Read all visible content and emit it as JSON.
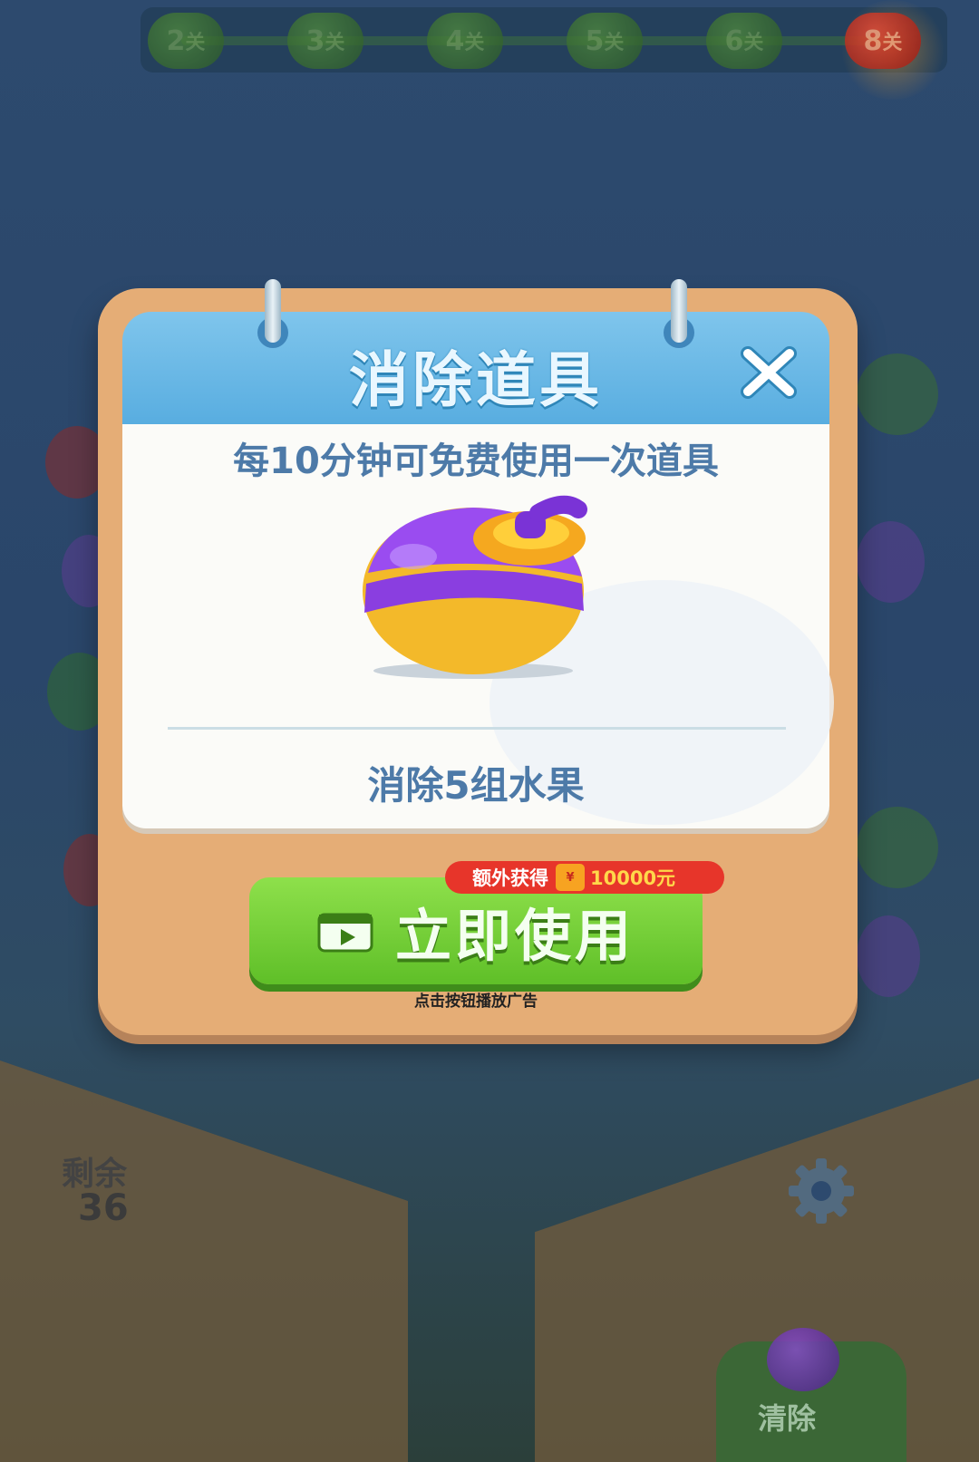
{
  "level_bar": {
    "levels": [
      {
        "num": "2",
        "suffix": "关"
      },
      {
        "num": "3",
        "suffix": "关"
      },
      {
        "num": "4",
        "suffix": "关"
      },
      {
        "num": "5",
        "suffix": "关"
      },
      {
        "num": "6",
        "suffix": "关"
      },
      {
        "num": "8",
        "suffix": "关"
      }
    ],
    "current_level_index": 5
  },
  "modal": {
    "title": "消除道具",
    "subtitle": "每10分钟可免费使用一次道具",
    "item_name_icon": "purple-bomb-icon",
    "description": "消除5组水果",
    "bonus_label": "额外获得",
    "bonus_amount": "10000元",
    "button_label": "立即使用",
    "ad_hint": "点击按钮播放广告",
    "colors": {
      "header": "#58ade0",
      "frame": "#e5ad76",
      "button": "#6fcf35",
      "bonus_pill": "#e7352a"
    }
  },
  "status": {
    "remaining_label": "剩余",
    "remaining_count": "36"
  },
  "bottom": {
    "clear_label": "清除"
  }
}
